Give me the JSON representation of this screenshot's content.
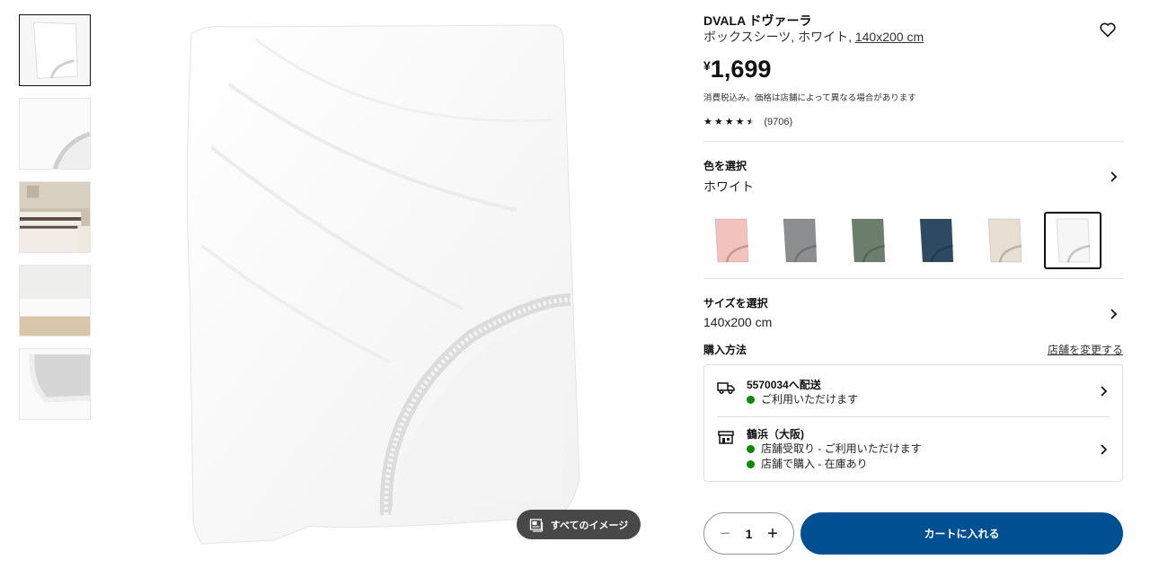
{
  "thumbnails": [
    {
      "name": "thumb-sheet-white",
      "selected": true
    },
    {
      "name": "thumb-closeup-elastic",
      "selected": false
    },
    {
      "name": "thumb-bedroom",
      "selected": false
    },
    {
      "name": "thumb-mattress",
      "selected": false
    },
    {
      "name": "thumb-corner",
      "selected": false
    }
  ],
  "view_all": {
    "label": "すべてのイメージ",
    "icon": "gallery-icon"
  },
  "product": {
    "name": "DVALA ドヴァーラ",
    "desc_prefix": "ボックスシーツ, ホワイト, ",
    "size_link": "140x200 cm",
    "price_currency": "¥",
    "price_amount": "1,699",
    "tax_note": "消費税込み。価格は店舗によって異なる場合があります",
    "rating": 4.5,
    "review_count": "(9706)"
  },
  "color_section": {
    "label": "色を選択",
    "value": "ホワイト",
    "swatches": [
      {
        "name": "pink",
        "color": "#f2c2bd",
        "selected": false
      },
      {
        "name": "grey",
        "color": "#8c8f8f",
        "selected": false
      },
      {
        "name": "green",
        "color": "#6c7f6d",
        "selected": false
      },
      {
        "name": "blue",
        "color": "#2e4a63",
        "selected": false
      },
      {
        "name": "beige",
        "color": "#e8dfd2",
        "selected": false
      },
      {
        "name": "white",
        "color": "#f6f6f6",
        "selected": true
      }
    ]
  },
  "size_section": {
    "label": "サイズを選択",
    "value": "140x200 cm"
  },
  "purchase": {
    "label": "購入方法",
    "change_store": "店舗を変更する",
    "delivery": {
      "title": "5570034へ配送",
      "status": "ご利用いただけます",
      "icon": "truck-icon"
    },
    "store": {
      "title": "鶴浜（大阪)",
      "status1": "店舗受取り - ご利用いただけます",
      "status2": "店舗で購入 - 在庫あり",
      "icon": "store-icon"
    },
    "status_color": "#0a8a00"
  },
  "cart": {
    "quantity": "1",
    "minus": "−",
    "plus": "+",
    "add_label": "カートに入れる",
    "button_color": "#004f93"
  }
}
